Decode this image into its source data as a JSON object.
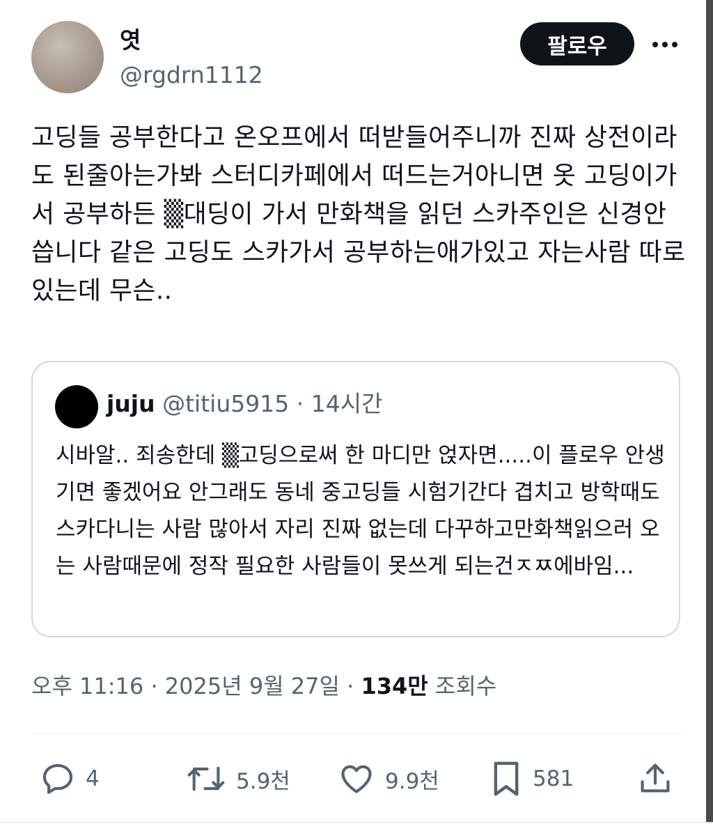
{
  "user": {
    "display_name": "엿",
    "handle": "@rgdrn1112",
    "follow_label": "팔로우"
  },
  "tweet": {
    "text": "고딩들 공부한다고 온오프에서 떠받들어주니까 진짜 상전이라도 된줄아는가봐 스터디카페에서 떠드는거아니면 옷 고딩이가서 공부하든 ▒대딩이 가서 만화책을 읽던 스카주인은 신경안씁니다 같은 고딩도 스카가서 공부하는애가있고 자는사람 따로있는데 무슨..",
    "timestamp": "오후 11:16 · 2025년 9월 27일 · ",
    "views_count": "134만",
    "views_label": " 조회수"
  },
  "quote": {
    "name": "juju",
    "handle": "@titiu5915",
    "separator": " · ",
    "time": "14시간",
    "text": "시바알.. 죄송한데 ▒고딩으로써 한 마디만 얹자면.....이 플로우 안생기면 좋겠어요 안그래도 동네 중고딩들 시험기간다 겹치고 방학때도 스카다니는 사람 많아서 자리 진짜 없는데 다꾸하고만화책읽으러 오는 사람때문에 정작 필요한 사람들이 못쓰게 되는건ㅈㅉ에바임..."
  },
  "actions": {
    "reply_count": "4",
    "retweet_count": "5.9천",
    "like_count": "9.9천",
    "bookmark_count": "581"
  },
  "icons": [
    "more-icon",
    "reply-icon",
    "retweet-icon",
    "like-icon",
    "bookmark-icon",
    "share-icon"
  ],
  "colors": {
    "text": "#0f1419",
    "secondary": "#536471",
    "border": "#cfd9de",
    "button": "#0f1419"
  }
}
